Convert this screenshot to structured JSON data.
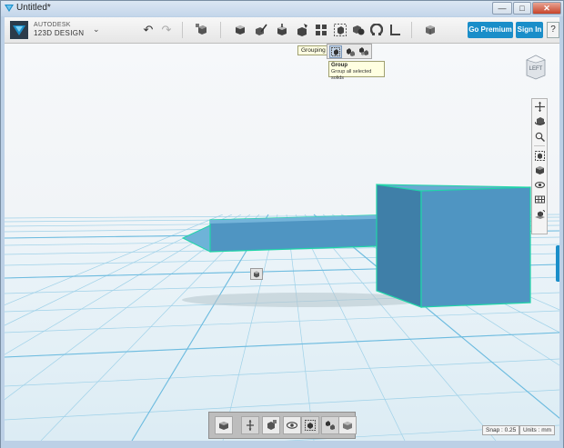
{
  "window": {
    "title": "Untitled*",
    "controls": {
      "minimize": "—",
      "maximize": "□",
      "close": "✕"
    }
  },
  "brand": {
    "line1": "AUTODESK",
    "line2": "123D DESIGN",
    "menu_chevron": "⌄"
  },
  "toolbar": {
    "icons": [
      "undo-icon",
      "redo-icon",
      "transform-icon",
      "primitives-icon",
      "sketch-icon",
      "construct-icon",
      "modify-icon",
      "pattern-icon",
      "grouping-icon",
      "combine-icon",
      "snap-icon",
      "measure-icon",
      "material-icon"
    ],
    "undo_glyph": "↶",
    "redo_glyph": "↷",
    "premium_label": "Go Premium",
    "signin_label": "Sign In",
    "help_label": "?"
  },
  "grouping_submenu": {
    "label": "Grouping",
    "items": [
      "group-icon",
      "ungroup-icon",
      "ungroup-all-icon"
    ],
    "tooltip_title": "Group",
    "tooltip_desc": "Group all selected solids"
  },
  "viewcube": {
    "face_label": "LEFT"
  },
  "nav_tools": [
    "pan-icon",
    "orbit-icon",
    "zoom-icon",
    "fit-icon",
    "view-mode-icon",
    "visibility-icon",
    "materials-toggle-icon",
    "grid-toggle-icon"
  ],
  "bottom_toolbar": [
    "solid-view-icon",
    "move-icon",
    "transform-icon",
    "visibility-icon",
    "group-icon",
    "ungroup-icon",
    "material-icon"
  ],
  "status": {
    "snap": "Snap : 0.25",
    "units": "Units : mm"
  },
  "colors": {
    "accent": "#1a8ec9",
    "solid_fill": "#4f95c2",
    "solid_edge": "#1fd5a8"
  }
}
